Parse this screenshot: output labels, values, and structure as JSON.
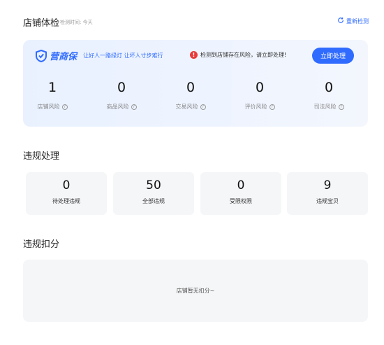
{
  "header": {
    "title": "店铺体检",
    "check_time": "检测时间: 今天",
    "recheck_label": "重新检测"
  },
  "health_card": {
    "brand_name": "营商保",
    "slogan": "让好人一路绿灯 让坏人寸步难行",
    "warning_text": "检测到店铺存在风险，请立即处理!",
    "action_label": "立即处理",
    "risks": [
      {
        "label": "店铺风险",
        "value": "1"
      },
      {
        "label": "商品风险",
        "value": "0"
      },
      {
        "label": "交易风险",
        "value": "0"
      },
      {
        "label": "评价风险",
        "value": "0"
      },
      {
        "label": "司法风险",
        "value": "0"
      }
    ]
  },
  "violation": {
    "title": "违规处理",
    "stats": [
      {
        "label": "待处理违规",
        "value": "0"
      },
      {
        "label": "全部违规",
        "value": "50"
      },
      {
        "label": "受限权限",
        "value": "0"
      },
      {
        "label": "违规宝贝",
        "value": "9"
      }
    ]
  },
  "deduction": {
    "title": "违规扣分",
    "empty_text": "店铺暂无扣分~"
  },
  "colors": {
    "accent": "#2f6bff",
    "warning": "#e83b3b"
  }
}
